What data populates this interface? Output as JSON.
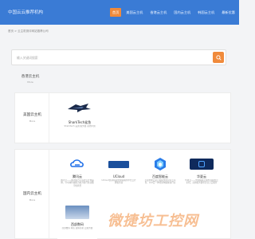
{
  "header": {
    "logo_text": "中国云云推荐机构",
    "nav": [
      {
        "label": "首页",
        "active": true
      },
      {
        "label": "美国云主机",
        "active": false
      },
      {
        "label": "香港云主机",
        "active": false
      },
      {
        "label": "国内云主机",
        "active": false
      },
      {
        "label": "韩国云主机",
        "active": false
      },
      {
        "label": "最新优惠",
        "active": false
      }
    ]
  },
  "breadcrumb": "首页 > 云主机测评网站推荐公司",
  "search": {
    "placeholder": "输入关键词搜索"
  },
  "sections": [
    {
      "title": "香港云主机",
      "subtitle": "More"
    },
    {
      "title": "美国云主机",
      "subtitle": "More",
      "cards": [
        {
          "name": "SharkTech鲨鱼",
          "desc": "Sharktech 美国 服务器 高防护国",
          "logo": "sharktech-logo"
        }
      ]
    },
    {
      "title": "国内云主机",
      "subtitle": "More",
      "cards": [
        {
          "name": "腾讯云",
          "desc": "腾讯云——腾讯倾力打造的云计算品牌，以卓越科技能力助力各行各业数字化转型",
          "logo": "tencent-cloud-logo"
        },
        {
          "name": "UCloud",
          "desc": "UCloud优刻得是中国领先的中立云计算服务商",
          "logo": "ucloud-logo"
        },
        {
          "name": "百度智能云",
          "desc": "百度智能云是百度提供的公有云平台，以AI云一体化架构赋能各行业",
          "logo": "baidu-cloud-logo"
        },
        {
          "name": "华夏云",
          "desc": "华夏云——中国领先云服务商提供云主机，高防服务器等企业上云服务",
          "logo": "huaxia-cloud-logo"
        },
        {
          "name": "西部数码",
          "desc": "西部数码 域名 虚拟主机 云服务器",
          "logo": "west-digital-logo"
        }
      ]
    }
  ],
  "watermark": "微捷坊工控网",
  "colors": {
    "header": "#3a7bd5",
    "accent": "#f08a3b"
  }
}
